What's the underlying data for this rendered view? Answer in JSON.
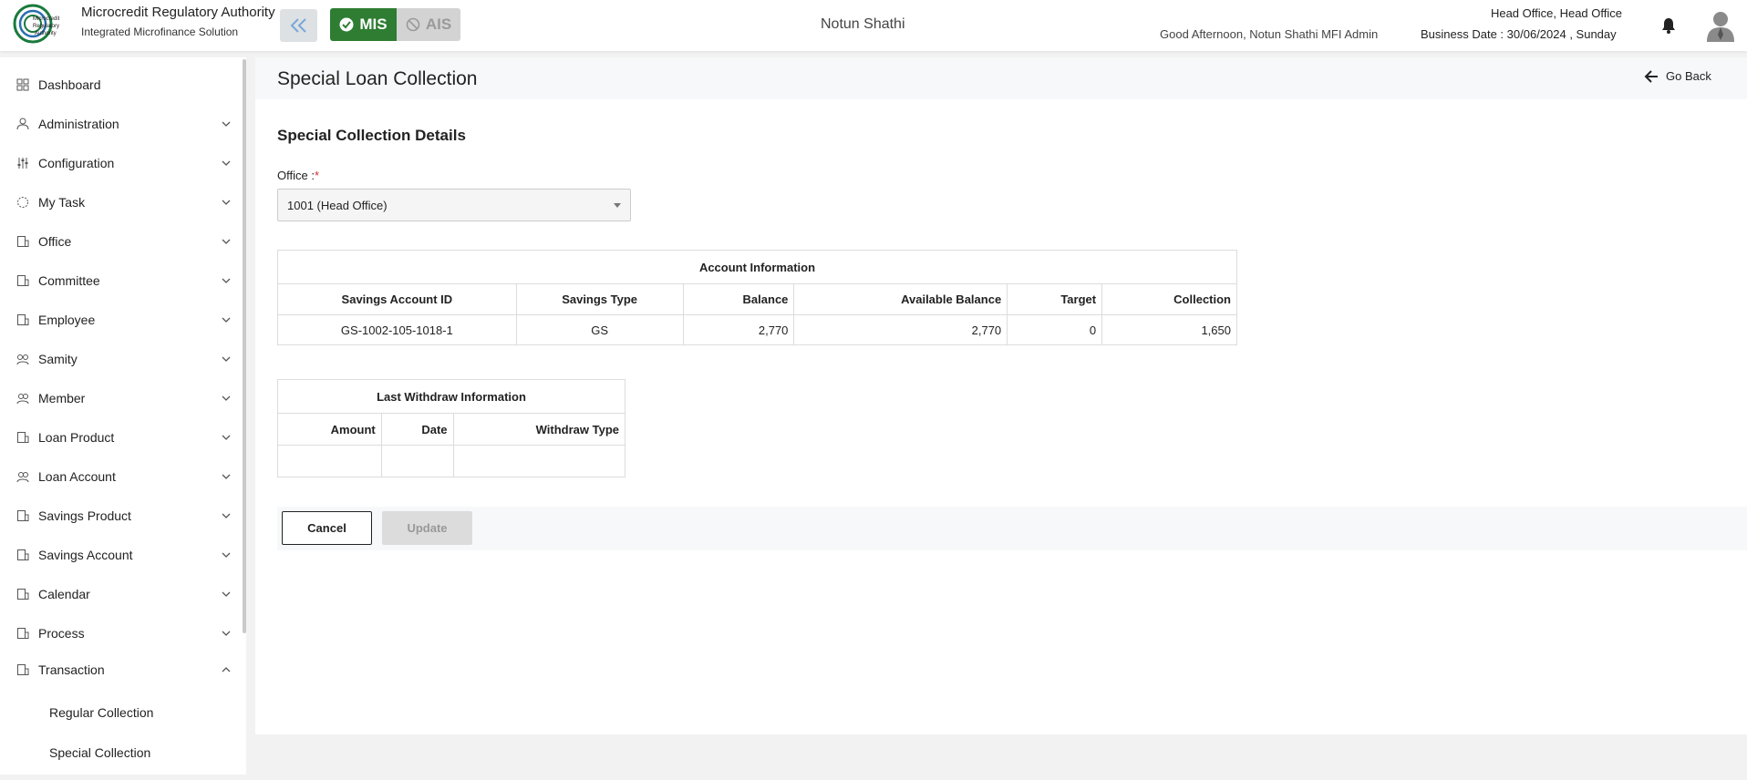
{
  "header": {
    "org_name": "Microcredit Regulatory Authority",
    "org_sub": "Integrated Microfinance Solution",
    "mis_label": "MIS",
    "ais_label": "AIS",
    "center_title": "Notun Shathi",
    "greeting": "Good Afternoon, Notun Shathi MFI Admin",
    "office": "Head Office, Head Office",
    "business_date": "Business Date : 30/06/2024 , Sunday",
    "logo_text": "Microcredit Regulatory Authority",
    "accent_color": "#2e7d32"
  },
  "sidebar": {
    "items": [
      {
        "label": "Dashboard",
        "icon": "grid-icon"
      },
      {
        "label": "Administration",
        "icon": "admin-icon"
      },
      {
        "label": "Configuration",
        "icon": "sliders-icon"
      },
      {
        "label": "My Task",
        "icon": "task-icon"
      },
      {
        "label": "Office",
        "icon": "office-icon"
      },
      {
        "label": "Committee",
        "icon": "committee-icon"
      },
      {
        "label": "Employee",
        "icon": "employee-icon"
      },
      {
        "label": "Samity",
        "icon": "samity-icon"
      },
      {
        "label": "Member",
        "icon": "member-icon"
      },
      {
        "label": "Loan Product",
        "icon": "loan-product-icon"
      },
      {
        "label": "Loan Account",
        "icon": "loan-account-icon"
      },
      {
        "label": "Savings Product",
        "icon": "savings-product-icon"
      },
      {
        "label": "Savings Account",
        "icon": "savings-account-icon"
      },
      {
        "label": "Calendar",
        "icon": "calendar-icon"
      },
      {
        "label": "Process",
        "icon": "process-icon"
      },
      {
        "label": "Transaction",
        "icon": "transaction-icon"
      }
    ],
    "sub_items": [
      "Regular Collection",
      "Special Collection"
    ]
  },
  "page": {
    "title": "Special Loan Collection",
    "go_back": "Go Back",
    "section_title": "Special Collection Details",
    "office_label": "Office :",
    "office_required": "*",
    "office_value": "1001 (Head Office)"
  },
  "account_info": {
    "caption": "Account Information",
    "headers": [
      "Savings Account ID",
      "Savings Type",
      "Balance",
      "Available Balance",
      "Target",
      "Collection"
    ],
    "row": [
      "GS-1002-105-1018-1",
      "GS",
      "2,770",
      "2,770",
      "0",
      "1,650"
    ]
  },
  "withdraw_info": {
    "caption": "Last Withdraw Information",
    "headers": [
      "Amount",
      "Date",
      "Withdraw Type"
    ]
  },
  "actions": {
    "cancel": "Cancel",
    "update": "Update"
  }
}
